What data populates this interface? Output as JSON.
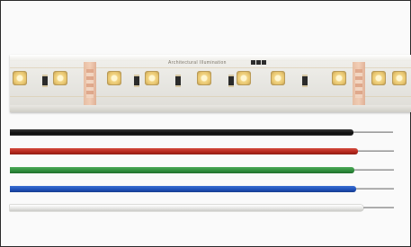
{
  "image": {
    "strip_print_text": "Architectural Illumination"
  }
}
